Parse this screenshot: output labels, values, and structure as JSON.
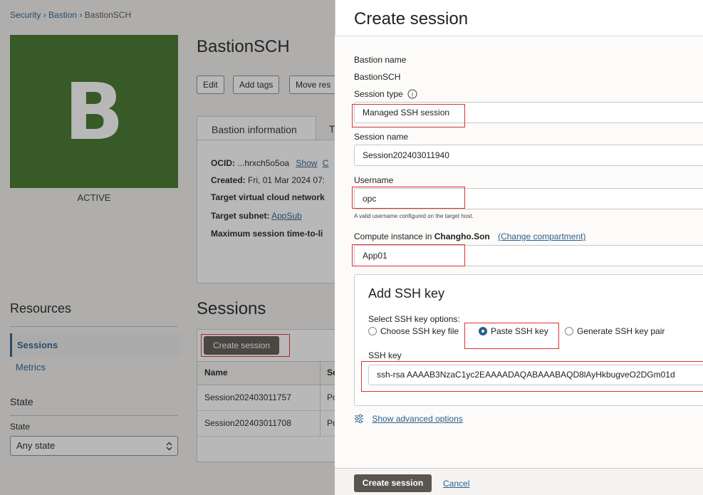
{
  "breadcrumb": {
    "security": "Security",
    "bastion": "Bastion",
    "current": "BastionSCH",
    "sep": "›"
  },
  "bastion": {
    "initial": "B",
    "status": "ACTIVE",
    "title": "BastionSCH",
    "buttons": {
      "edit": "Edit",
      "add_tags": "Add tags",
      "move": "Move res"
    },
    "tabs": {
      "info": "Bastion information",
      "next": "T"
    },
    "info": {
      "ocid_label": "OCID:",
      "ocid_value": "...hrxch5o5oa",
      "ocid_show": "Show",
      "ocid_copy": "C",
      "created_label": "Created:",
      "created_value": "Fri, 01 Mar 2024 07:",
      "target_vcn_label": "Target virtual cloud network",
      "target_subnet_label": "Target subnet:",
      "target_subnet_value": "AppSub",
      "max_ttl_label": "Maximum session time-to-li"
    }
  },
  "resources": {
    "heading": "Resources",
    "items": [
      "Sessions",
      "Metrics"
    ],
    "state_heading": "State",
    "state_label": "State",
    "state_value": "Any state"
  },
  "sessions": {
    "title": "Sessions",
    "create_label": "Create session",
    "columns": {
      "name": "Name",
      "second": "Se"
    },
    "rows": [
      {
        "name": "Session202403011757",
        "second": "Po"
      },
      {
        "name": "Session202403011708",
        "second": "Po"
      }
    ]
  },
  "panel": {
    "title": "Create session",
    "bastion_name_label": "Bastion name",
    "bastion_name_value": "BastionSCH",
    "session_type_label": "Session type",
    "session_type_value": "Managed SSH session",
    "session_name_label": "Session name",
    "session_name_value": "Session202403011940",
    "username_label": "Username",
    "username_value": "opc",
    "username_hint": "A valid username configured on the target host.",
    "compute_label_prefix": "Compute instance in",
    "compute_compartment": "Changho.Son",
    "change_compartment": "(Change compartment)",
    "compute_value": "App01",
    "ssh_card": {
      "title": "Add SSH key",
      "options_label": "Select SSH key options:",
      "options": [
        "Choose SSH key file",
        "Paste SSH key",
        "Generate SSH key pair"
      ],
      "selected_option": "Paste SSH key",
      "ssh_key_label": "SSH key",
      "ssh_key_value": "ssh-rsa AAAAB3NzaC1yc2EAAAADAQABAAABAQD8lAyHkbugveO2DGm01d"
    },
    "advanced_link": "Show advanced options",
    "create_button": "Create session",
    "cancel_link": "Cancel"
  },
  "colors": {
    "brand_avatar": "#3f7426",
    "link": "#2b5e8a",
    "primary_button": "#5b5550",
    "highlight": "#e03030"
  },
  "icons": [
    "info-icon",
    "chevron-updown-icon",
    "settings-sliders-icon"
  ]
}
